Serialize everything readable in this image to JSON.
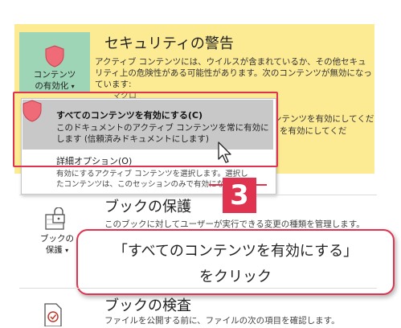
{
  "colors": {
    "banner_bg": "#fdeb94",
    "enable_button_bg": "#9fd5b7",
    "accent_red": "#e0334f",
    "menu_highlight": "#c8c8c8",
    "shield_fill": "#ef6b77"
  },
  "security_warning": {
    "button_label_line1": "コンテンツ",
    "button_label_line2": "の有効化",
    "dropdown_caret": "▾",
    "title": "セキュリティの警告",
    "description": "アクティブ コンテンツには、ウイルスが含まれているか、その他セキュリティ上の危険性がある可能性があります。次のコンテンツが無効になっています:",
    "partial_item": "マクロ",
    "partial_right_1": "ンテンツを有効にしてくだ",
    "partial_right_2": "を有効にしてくだ"
  },
  "dropdown_menu": {
    "enable_all_label": "すべてのコンテンツを有効にする(C)",
    "enable_all_desc": "このドキュメントのアクティブ コンテンツを常に有効にします (信頼済みドキュメントにします)",
    "advanced_label": "詳細オプション(O)",
    "advanced_desc_line1": "有効にするアクティブ コンテンツを選択します。選択し",
    "advanced_desc_line2": "たコンテンツは、このセッションのみで有効にな"
  },
  "protect_workbook": {
    "button_label_line1": "ブックの",
    "button_label_line2": "保護",
    "dropdown_caret": "▾",
    "icon": "lock-icon",
    "title": "ブックの保護",
    "description": "このブックに対してユーザーが実行できる変更の種類を管理します。"
  },
  "inspect_workbook": {
    "icon": "inspect-icon",
    "title": "ブックの検査",
    "description": "ファイルを公開する前に、ファイルの次の項目を確認します。"
  },
  "annotation": {
    "step_number": "3",
    "callout_line1": "「すべてのコンテンツを有効にする」",
    "callout_line2": "をクリック"
  },
  "cursor_icon": "mouse-pointer-icon"
}
